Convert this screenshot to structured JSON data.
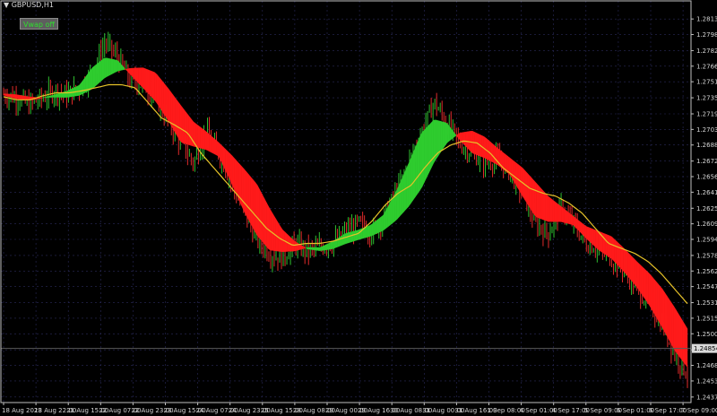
{
  "symbol_label": "GBPUSD,H1",
  "vwap_button_label": "Vwap off",
  "colors": {
    "background": "#000000",
    "frame": "#bfbfbf",
    "grid": "#2a2a5a",
    "bull_candle": "#2fbf2f",
    "bear_candle": "#e02a2a",
    "cloud_up": "#2ecc2e",
    "cloud_down": "#ff1a1a",
    "vwap_line": "#e6c229",
    "current_price_line": "#5a5a5a"
  },
  "chart_data": {
    "type": "candlestick",
    "symbol": "GBPUSD",
    "timeframe": "H1",
    "ylim": [
      1.24315,
      1.28315
    ],
    "y_ticks": [
      "1.28135",
      "1.27980",
      "1.27820",
      "1.27665",
      "1.27510",
      "1.27350",
      "1.27190",
      "1.27035",
      "1.26880",
      "1.26720",
      "1.26565",
      "1.26410",
      "1.26250",
      "1.26095",
      "1.25940",
      "1.25780",
      "1.25625",
      "1.25470",
      "1.25310",
      "1.25155",
      "1.25000",
      "1.24840",
      "1.24685",
      "1.24530",
      "1.24370"
    ],
    "x_ticks": [
      "18 Aug 2023",
      "18 Aug 22:00",
      "21 Aug 15:00",
      "22 Aug 07:00",
      "22 Aug 23:00",
      "23 Aug 15:00",
      "24 Aug 07:00",
      "24 Aug 23:00",
      "25 Aug 15:00",
      "28 Aug 08:00",
      "29 Aug 00:00",
      "29 Aug 16:00",
      "30 Aug 08:00",
      "31 Aug 00:00",
      "31 Aug 16:00",
      "1 Sep 08:00",
      "4 Sep 01:00",
      "4 Sep 17:00",
      "5 Sep 09:00",
      "6 Sep 01:00",
      "6 Sep 17:00",
      "7 Sep 09:00"
    ],
    "current_price": "1.24854",
    "series": [
      {
        "role": "price_path",
        "values": [
          1.2739,
          1.2735,
          1.2728,
          1.2734,
          1.2742,
          1.2738,
          1.2745,
          1.276,
          1.279,
          1.2775,
          1.2752,
          1.2748,
          1.2735,
          1.2712,
          1.269,
          1.267,
          1.27,
          1.268,
          1.265,
          1.262,
          1.2595,
          1.258,
          1.2575,
          1.259,
          1.2582,
          1.2586,
          1.259,
          1.26,
          1.261,
          1.26,
          1.2615,
          1.264,
          1.267,
          1.27,
          1.273,
          1.271,
          1.269,
          1.268,
          1.267,
          1.2675,
          1.266,
          1.264,
          1.261,
          1.26,
          1.2625,
          1.261,
          1.259,
          1.2585,
          1.2575,
          1.2565,
          1.2545,
          1.253,
          1.251,
          1.248,
          1.246
        ]
      },
      {
        "role": "vwap",
        "values": [
          1.2736,
          1.2733,
          1.2733,
          1.2737,
          1.274,
          1.274,
          1.2742,
          1.2745,
          1.2748,
          1.2748,
          1.2745,
          1.273,
          1.2715,
          1.2708,
          1.27,
          1.268,
          1.2665,
          1.265,
          1.2635,
          1.262,
          1.2605,
          1.2595,
          1.2588,
          1.259,
          1.259,
          1.2592,
          1.2596,
          1.26,
          1.2612,
          1.2628,
          1.264,
          1.2648,
          1.2665,
          1.268,
          1.2688,
          1.2692,
          1.269,
          1.268,
          1.2665,
          1.2655,
          1.2645,
          1.264,
          1.2637,
          1.263,
          1.262,
          1.2605,
          1.259,
          1.2585,
          1.258,
          1.2572,
          1.256,
          1.2545,
          1.253
        ]
      }
    ]
  }
}
